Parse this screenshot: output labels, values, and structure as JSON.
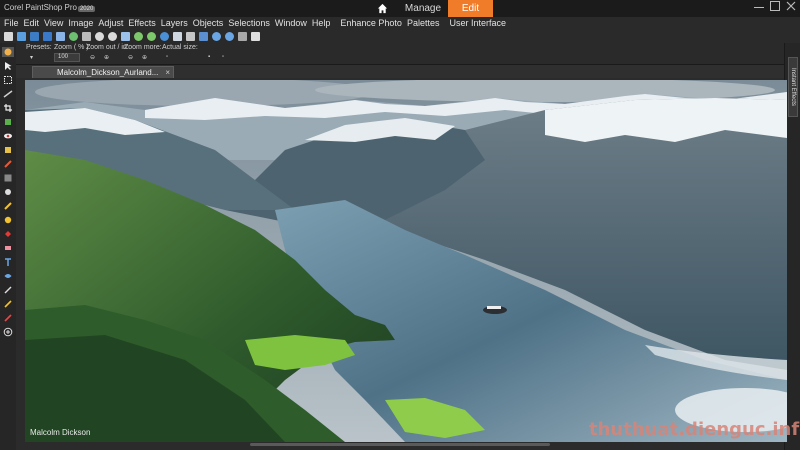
{
  "titlebar": {
    "app_name": "Corel PaintShop Pro",
    "version_badge": "2020",
    "home_icon": "home-icon",
    "tabs": [
      {
        "label": "Manage"
      },
      {
        "label": "Edit",
        "active": true
      }
    ],
    "accent_color": "#f07c2a"
  },
  "menubar": {
    "items": [
      "File",
      "Edit",
      "View",
      "Image",
      "Adjust",
      "Effects",
      "Layers",
      "Objects",
      "Selections",
      "Window",
      "Help"
    ],
    "extra_items": [
      "Enhance Photo",
      "Palettes",
      "User Interface"
    ]
  },
  "tool_options": {
    "presets_label": "Presets:",
    "zoom_label": "Zoom ( % ):",
    "zoom_value": "100",
    "zoom_out_in_label": "Zoom out / in:",
    "zoom_more_label": "Zoom more:",
    "actual_size_label": "Actual size:"
  },
  "right_panel": {
    "palette_tab": "Instant Effects"
  },
  "document": {
    "tab_title": "Malcolm_Dickson_Aurland...",
    "close_glyph": "×",
    "credit": "Malcolm Dickson"
  },
  "watermark": {
    "text": "thuthuat.dienguc.info"
  }
}
